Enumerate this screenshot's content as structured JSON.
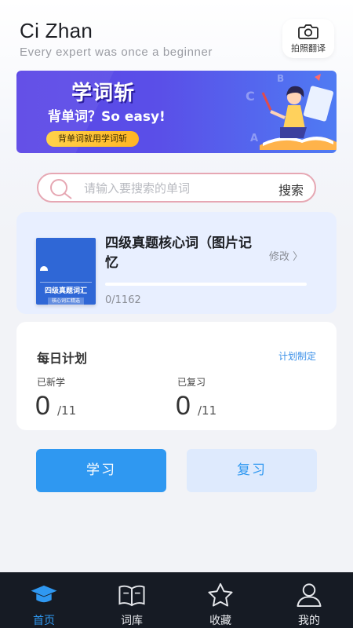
{
  "header": {
    "title": "Ci Zhan",
    "slogan": "Every expert was once a beginner",
    "photo_translate_label": "拍照翻译",
    "photo_translate_icon": "camera-icon"
  },
  "banner": {
    "title": "学词斩",
    "subtitle": "背单词？So easy!",
    "pill": "背单词就用学词斩"
  },
  "search": {
    "placeholder": "请输入要搜索的单词",
    "button_label": "搜索"
  },
  "book": {
    "title": "四级真题核心词（图片记忆",
    "modify_label": "修改 〉",
    "progress_text": "0/1162",
    "progress_learned": 0,
    "progress_total": 1162,
    "cover_title": "四级真题词汇",
    "cover_sub": "核心词汇精选"
  },
  "plan": {
    "title": "每日计划",
    "link": "计划制定",
    "new_label": "已新学",
    "new_value": "0",
    "new_total": "/11",
    "review_label": "已复习",
    "review_value": "0",
    "review_total": "/11"
  },
  "actions": {
    "study": "学习",
    "review": "复习"
  },
  "tabs": [
    {
      "label": "首页",
      "icon": "graduation-cap-icon",
      "active": true
    },
    {
      "label": "词库",
      "icon": "open-book-icon",
      "active": false
    },
    {
      "label": "收藏",
      "icon": "star-icon",
      "active": false
    },
    {
      "label": "我的",
      "icon": "user-icon",
      "active": false
    }
  ],
  "colors": {
    "accent": "#2f98f1",
    "banner": "#5b46e6",
    "tabbar": "#161b24"
  }
}
